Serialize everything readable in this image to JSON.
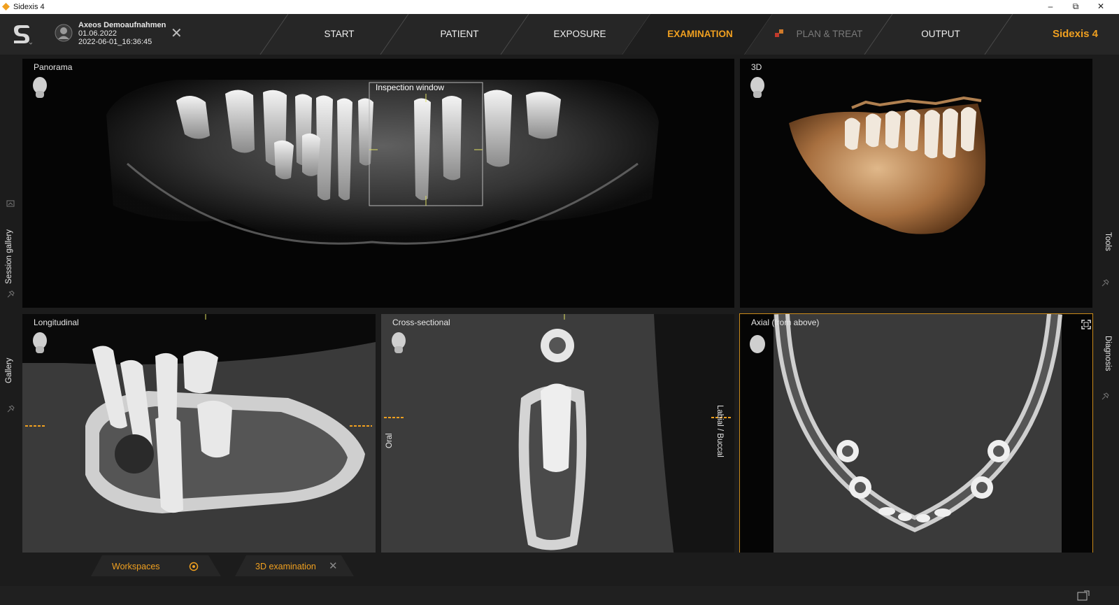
{
  "window": {
    "title": "Sidexis 4"
  },
  "patient": {
    "name": "Axeos Demoaufnahmen",
    "date": "01.06.2022",
    "session": "2022-06-01_16:36:45"
  },
  "nav": {
    "tabs": [
      {
        "label": "START",
        "state": "normal"
      },
      {
        "label": "PATIENT",
        "state": "normal"
      },
      {
        "label": "EXPOSURE",
        "state": "normal"
      },
      {
        "label": "EXAMINATION",
        "state": "active"
      },
      {
        "label": "PLAN & TREAT",
        "state": "disabled"
      },
      {
        "label": "OUTPUT",
        "state": "normal"
      }
    ],
    "brand": "Sidexis 4"
  },
  "sidebars": {
    "left": [
      "Session gallery",
      "Gallery"
    ],
    "right": [
      "Tools",
      "Diagnosis"
    ]
  },
  "panels": {
    "panorama": {
      "label": "Panorama",
      "inspection": "Inspection window"
    },
    "threed": {
      "label": "3D"
    },
    "longitudinal": {
      "label": "Longitudinal"
    },
    "cross": {
      "label": "Cross-sectional",
      "left_label": "Oral",
      "right_label": "Labial / Buccal"
    },
    "axial": {
      "label": "Axial (from above)"
    }
  },
  "bottom": {
    "workspaces": "Workspaces",
    "tab": "3D examination"
  },
  "colors": {
    "accent": "#f0a020",
    "background": "#1c1c1c",
    "panel": "#050505"
  }
}
